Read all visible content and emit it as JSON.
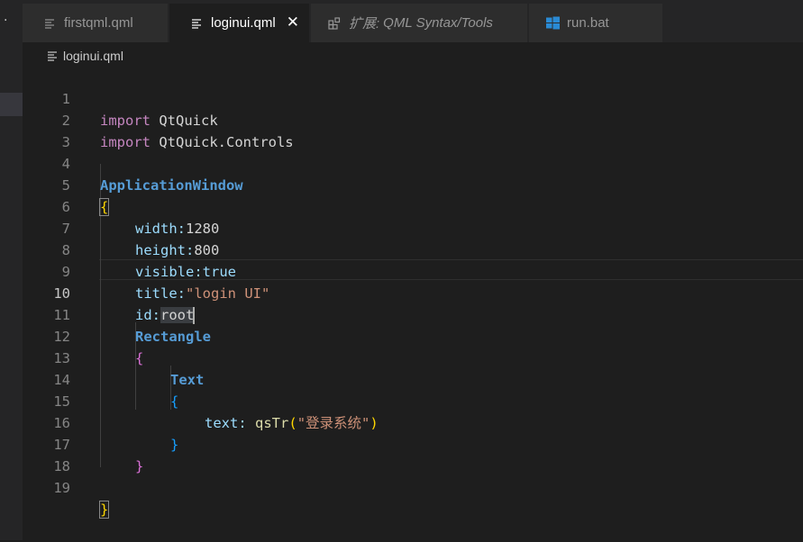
{
  "tabs": [
    {
      "label": "firstqml.qml",
      "icon": "lines-file-icon",
      "active": false
    },
    {
      "label": "loginui.qml",
      "icon": "lines-file-icon",
      "active": true
    },
    {
      "prefix": "扩展:",
      "label": "QML Syntax/Tools",
      "icon": "extensions-icon",
      "active": false
    },
    {
      "label": "run.bat",
      "icon": "windows-icon",
      "active": false
    }
  ],
  "close_glyph": "✕",
  "breadcrumb": {
    "file": "loginui.qml"
  },
  "cursor_line": 10,
  "line_numbers": [
    "1",
    "2",
    "3",
    "4",
    "5",
    "6",
    "7",
    "8",
    "9",
    "10",
    "11",
    "12",
    "13",
    "14",
    "15",
    "16",
    "17",
    "18",
    "19"
  ],
  "code": {
    "l1": {
      "kw": "import",
      "rest": " QtQuick"
    },
    "l2": {
      "kw": "import",
      "rest": " QtQuick.Controls"
    },
    "l4": {
      "type": "ApplicationWindow"
    },
    "l5": {
      "brace": "{"
    },
    "l6": {
      "prop": "width:",
      "val": "1280"
    },
    "l7": {
      "prop": "height:",
      "val": "800"
    },
    "l8": {
      "prop": "visible:",
      "val": "true"
    },
    "l9": {
      "prop": "title:",
      "str": "\"login UI\""
    },
    "l10": {
      "prop": "id:",
      "val": "root"
    },
    "l11": {
      "type": "Rectangle"
    },
    "l12": {
      "brace": "{"
    },
    "l13": {
      "type": "Text"
    },
    "l14": {
      "brace": "{"
    },
    "l15": {
      "prop": "text:",
      "func": "qsTr",
      "open": "(",
      "str": "\"登录系统\"",
      "close": ")"
    },
    "l16": {
      "brace": "}"
    },
    "l17": {
      "brace": "}"
    },
    "l19": {
      "brace": "}"
    }
  }
}
